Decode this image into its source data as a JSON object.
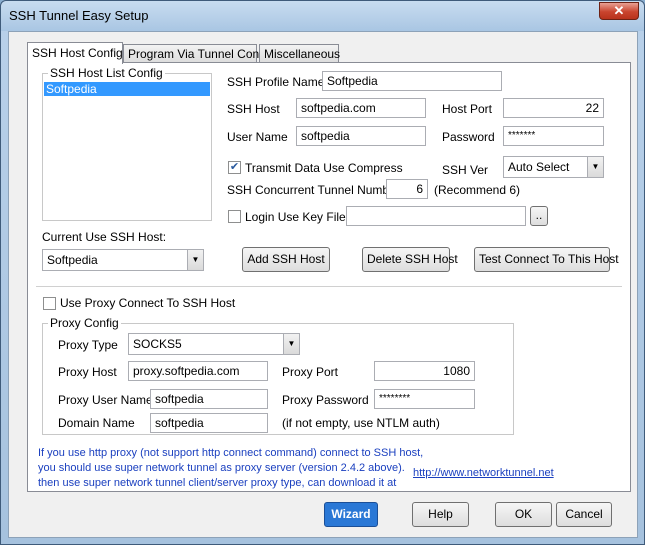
{
  "window": {
    "title": "SSH Tunnel Easy Setup",
    "close_icon": "close-icon"
  },
  "tabs": [
    "SSH  Host Config",
    "Program Via Tunnel Config",
    "Miscellaneous"
  ],
  "host_list": {
    "label": "SSH Host List Config",
    "items": [
      "Softpedia"
    ],
    "selected": 0
  },
  "form": {
    "profile_name_label": "SSH Profile Name",
    "profile_name": "Softpedia",
    "host_label": "SSH Host",
    "host": "softpedia.com",
    "port_label": "Host Port",
    "port": "22",
    "user_label": "User Name",
    "user": "softpedia",
    "password_label": "Password",
    "password": "*******",
    "compress_label": "Transmit Data Use Compress",
    "compress_checked": true,
    "ssh_ver_label": "SSH Ver",
    "ssh_ver": "Auto Select",
    "tunnel_num_label": "SSH Concurrent Tunnel Number:",
    "tunnel_num": "6",
    "tunnel_hint": "(Recommend 6)",
    "keyfile_label": "Login Use Key File:",
    "keyfile": "",
    "browse_label": "..",
    "current_host_label": "Current Use SSH Host:",
    "current_host": "Softpedia",
    "add_label": "Add  SSH Host",
    "delete_label": "Delete SSH Host",
    "test_label": "Test Connect To This Host"
  },
  "proxy": {
    "use_proxy_label": "Use Proxy Connect To SSH Host",
    "use_proxy_checked": false,
    "group_label": "Proxy Config",
    "type_label": "Proxy Type",
    "type": "SOCKS5",
    "host_label": "Proxy Host",
    "host": "proxy.softpedia.com",
    "port_label": "Proxy Port",
    "port": "1080",
    "user_label": "Proxy User Name",
    "user": "softpedia",
    "password_label": "Proxy Password",
    "password": "********",
    "domain_label": "Domain Name",
    "domain": "softpedia",
    "domain_hint": "(if not empty, use NTLM auth)"
  },
  "info": {
    "line1": "If you use http proxy (not support http connect command) connect to SSH host,",
    "line2": "you should use super network tunnel as proxy server (version 2.4.2 above).",
    "line3": "then use super network tunnel client/server proxy type, can download it at",
    "link": "http://www.networktunnel.net"
  },
  "buttons": {
    "wizard": "Wizard",
    "help": "Help",
    "ok": "OK",
    "cancel": "Cancel"
  }
}
